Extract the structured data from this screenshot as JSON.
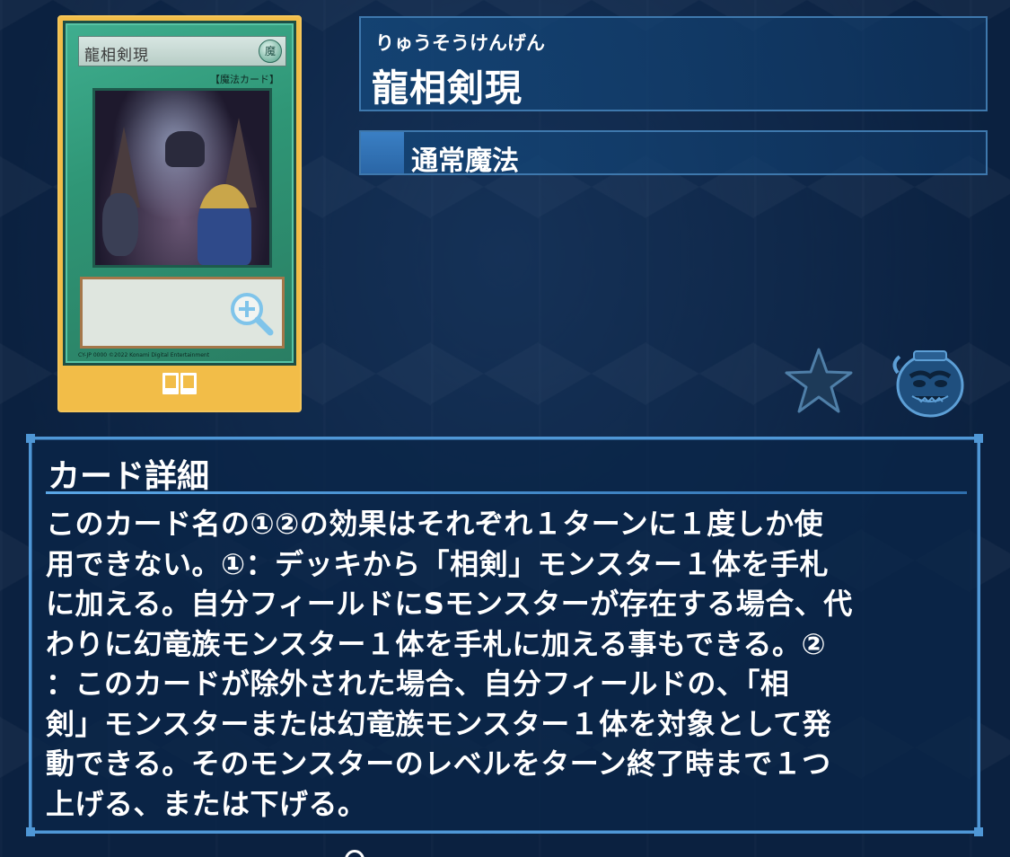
{
  "card": {
    "name_on_card": "龍相剣現",
    "type_label_on_card": "【魔法カード】",
    "footer_text": "CY-JP 0000 ©2022 Konami Digital Entertainment"
  },
  "header": {
    "reading": "りゅうそうけんげん",
    "name": "龍相剣現",
    "card_type": "通常魔法"
  },
  "details": {
    "title": "カード詳細",
    "description": "このカード名の①②の効果はそれぞれ１ターンに１度しか使\n用できない。①：デッキから「相剣」モンスター１体を手札\nに加える。自分フィールドにSモンスターが存在する場合、代\nわりに幻竜族モンスター１体を手札に加える事もできる。②\n：このカードが除外された場合、自分フィールドの、「相\n剣」モンスターまたは幻竜族モンスター１体を対象として発\n動できる。そのモンスターのレベルをターン終了時まで１つ\n上げる、または下げる。"
  },
  "icons": {
    "zoom": "zoom-in-icon",
    "boxes": "card-box-icon",
    "star": "favorite-star-icon",
    "pot": "pot-of-greed-icon"
  },
  "colors": {
    "background": "#0b2140",
    "card_frame": "#f2bd48",
    "panel_border": "#4f97d6",
    "spell_card": "#2f9676"
  }
}
